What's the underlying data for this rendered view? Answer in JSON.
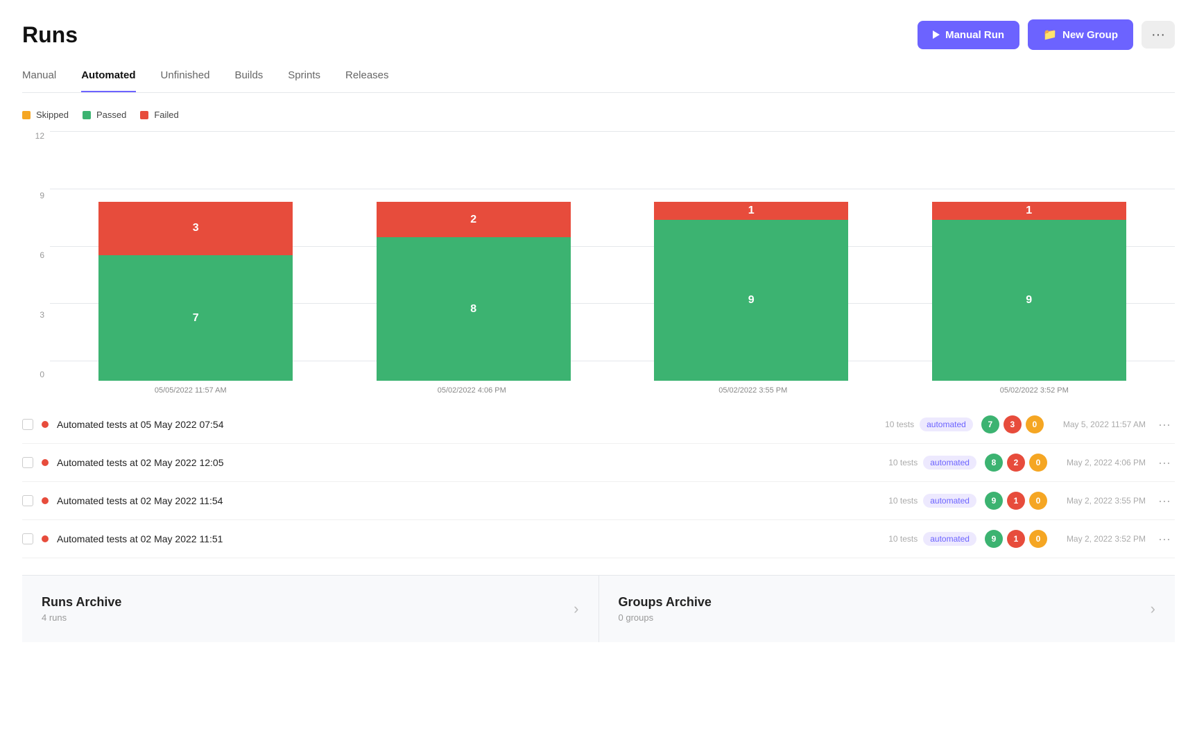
{
  "header": {
    "title": "Runs",
    "btn_manual_run": "Manual Run",
    "btn_new_group": "New Group",
    "btn_more": "..."
  },
  "tabs": [
    {
      "label": "Manual",
      "active": false
    },
    {
      "label": "Automated",
      "active": true
    },
    {
      "label": "Unfinished",
      "active": false
    },
    {
      "label": "Builds",
      "active": false
    },
    {
      "label": "Sprints",
      "active": false
    },
    {
      "label": "Releases",
      "active": false
    }
  ],
  "chart": {
    "legend": [
      {
        "label": "Skipped",
        "color": "#f5a623"
      },
      {
        "label": "Passed",
        "color": "#3cb371"
      },
      {
        "label": "Failed",
        "color": "#e74c3c"
      }
    ],
    "y_labels": [
      "0",
      "3",
      "6",
      "9",
      "12"
    ],
    "bars": [
      {
        "date": "05/05/2022 11:57 AM",
        "passed": 7,
        "failed": 3,
        "skipped": 0
      },
      {
        "date": "05/02/2022 4:06 PM",
        "passed": 8,
        "failed": 2,
        "skipped": 0
      },
      {
        "date": "05/02/2022 3:55 PM",
        "passed": 9,
        "failed": 1,
        "skipped": 0
      },
      {
        "date": "05/02/2022 3:52 PM",
        "passed": 9,
        "failed": 1,
        "skipped": 0
      }
    ],
    "max": 12
  },
  "runs": [
    {
      "name": "Automated tests at 05 May 2022 07:54",
      "tests": "10 tests",
      "tag": "automated",
      "passed": 7,
      "failed": 3,
      "skipped": 0,
      "date": "May 5, 2022 11:57 AM"
    },
    {
      "name": "Automated tests at 02 May 2022 12:05",
      "tests": "10 tests",
      "tag": "automated",
      "passed": 8,
      "failed": 2,
      "skipped": 0,
      "date": "May 2, 2022 4:06 PM"
    },
    {
      "name": "Automated tests at 02 May 2022 11:54",
      "tests": "10 tests",
      "tag": "automated",
      "passed": 9,
      "failed": 1,
      "skipped": 0,
      "date": "May 2, 2022 3:55 PM"
    },
    {
      "name": "Automated tests at 02 May 2022 11:51",
      "tests": "10 tests",
      "tag": "automated",
      "passed": 9,
      "failed": 1,
      "skipped": 0,
      "date": "May 2, 2022 3:52 PM"
    }
  ],
  "archive": {
    "runs": {
      "title": "Runs Archive",
      "subtitle": "4 runs"
    },
    "groups": {
      "title": "Groups Archive",
      "subtitle": "0 groups"
    }
  }
}
